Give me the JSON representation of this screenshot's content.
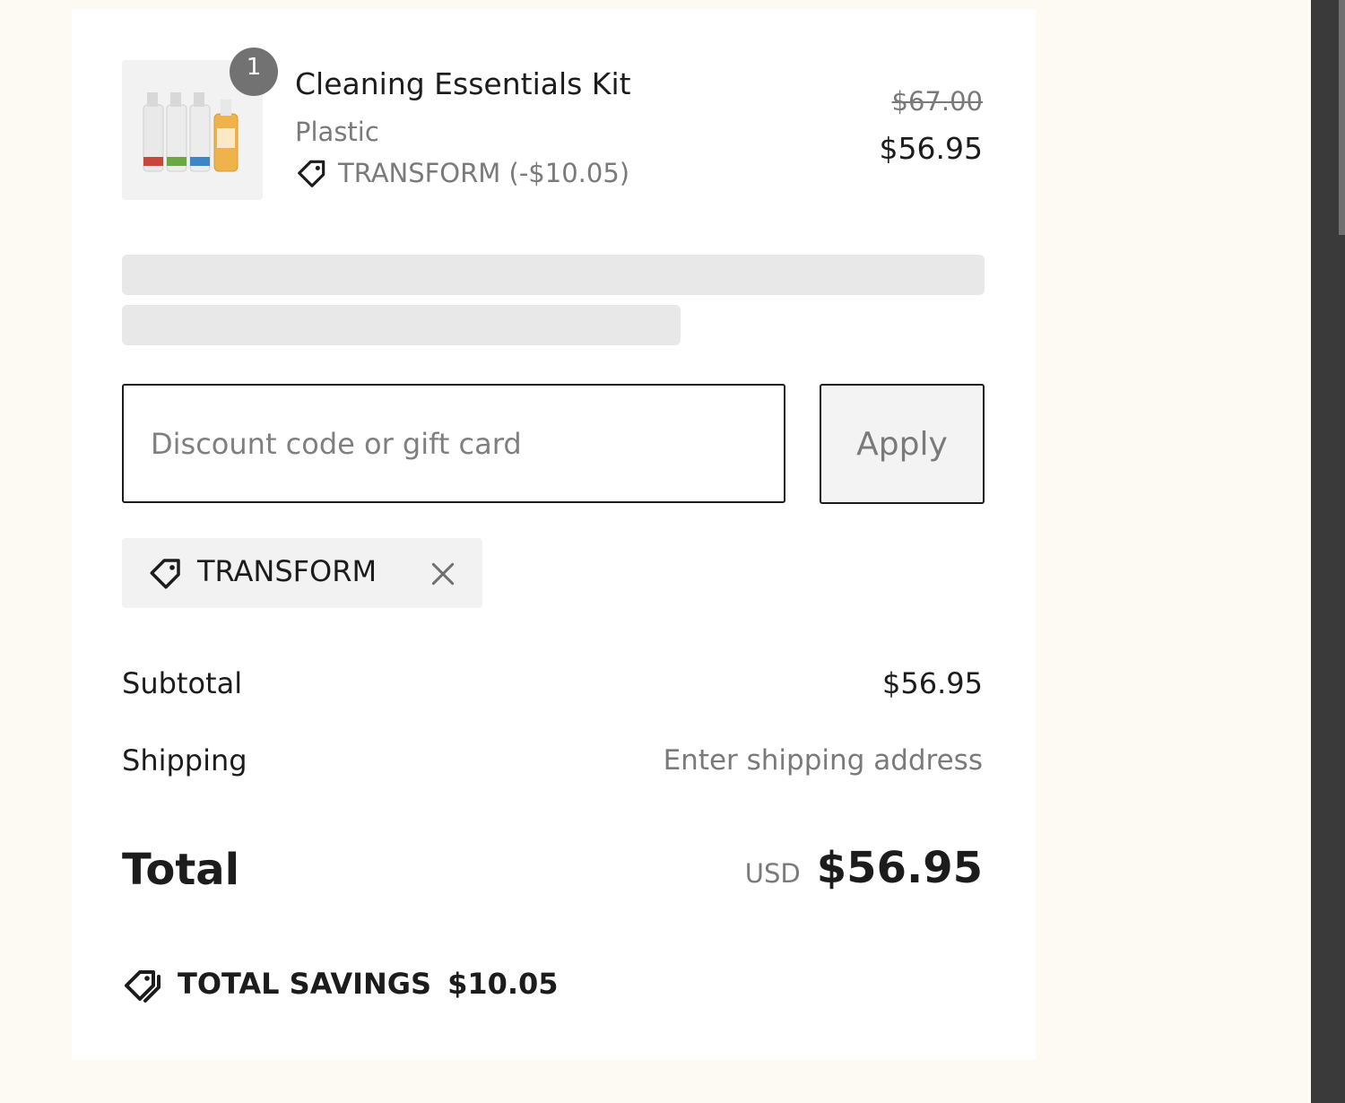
{
  "product": {
    "name": "Cleaning Essentials Kit",
    "variant": "Plastic",
    "quantity": "1",
    "discount_line": "TRANSFORM (-$10.05)",
    "original_price": "$67.00",
    "price": "$56.95"
  },
  "discount": {
    "placeholder": "Discount code or gift card",
    "apply_label": "Apply",
    "applied_code": "TRANSFORM"
  },
  "summary": {
    "subtotal_label": "Subtotal",
    "subtotal_value": "$56.95",
    "shipping_label": "Shipping",
    "shipping_value": "Enter shipping address",
    "total_label": "Total",
    "currency": "USD",
    "total_value": "$56.95",
    "savings_label": "TOTAL SAVINGS",
    "savings_value": "$10.05"
  },
  "icons": {
    "discount_tag": "tag-icon",
    "remove": "close-icon",
    "savings": "tags-icon"
  },
  "colors": {
    "page_background": "#fdf9f3",
    "card_background": "#ffffff",
    "text_primary": "#1c1c1c",
    "text_secondary": "#7a7a7a",
    "badge": "#727272",
    "skeleton": "#e8e8e8",
    "scrollbar": "#3a3a3a"
  }
}
